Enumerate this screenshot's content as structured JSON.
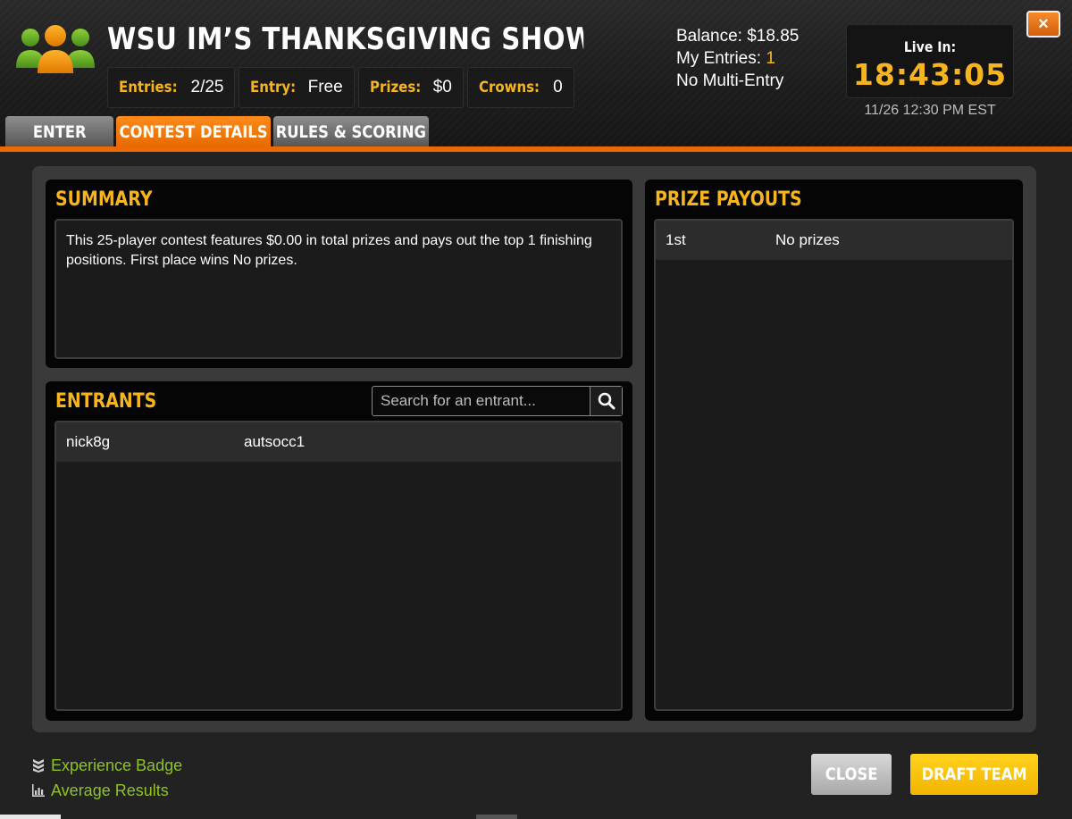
{
  "contest": {
    "title": "WSU IM’S THANKSGIVING SHOWDOW...",
    "stats": [
      {
        "label": "Entries:",
        "value": "2/25"
      },
      {
        "label": "Entry:",
        "value": "Free"
      },
      {
        "label": "Prizes:",
        "value": "$0"
      },
      {
        "label": "Crowns:",
        "value": "0"
      }
    ]
  },
  "account": {
    "balance": "Balance: $18.85",
    "entries_label": "My Entries:",
    "entries_value": "1",
    "multi_entry": "No Multi-Entry"
  },
  "countdown": {
    "label": "Live In:",
    "time": "18:43:05",
    "start": "11/26 12:30 PM EST"
  },
  "close_x": "×",
  "tabs": [
    {
      "label": "ENTER",
      "active": false
    },
    {
      "label": "CONTEST DETAILS",
      "active": true
    },
    {
      "label": "RULES & SCORING",
      "active": false
    }
  ],
  "summary": {
    "heading": "SUMMARY",
    "text": "This 25-player contest features $0.00 in total prizes and pays out the top 1 finishing positions. First place wins No prizes."
  },
  "entrants": {
    "heading": "ENTRANTS",
    "search_placeholder": "Search for an entrant...",
    "rows": [
      [
        "nick8g",
        "autsocc1"
      ]
    ]
  },
  "payouts": {
    "heading": "PRIZE PAYOUTS",
    "rows": [
      [
        "1st",
        "No prizes"
      ]
    ]
  },
  "footer": {
    "experience_badge": "Experience Badge",
    "average_results": "Average Results",
    "close": "CLOSE",
    "draft_team": "DRAFT TEAM"
  },
  "colors": {
    "accent_orange": "#ec6a05",
    "gold": "#f6b51e",
    "link_green": "#8fc31f"
  },
  "icons": [
    "users-icon",
    "close-icon",
    "search-icon",
    "badge-icon",
    "bar-chart-icon"
  ]
}
